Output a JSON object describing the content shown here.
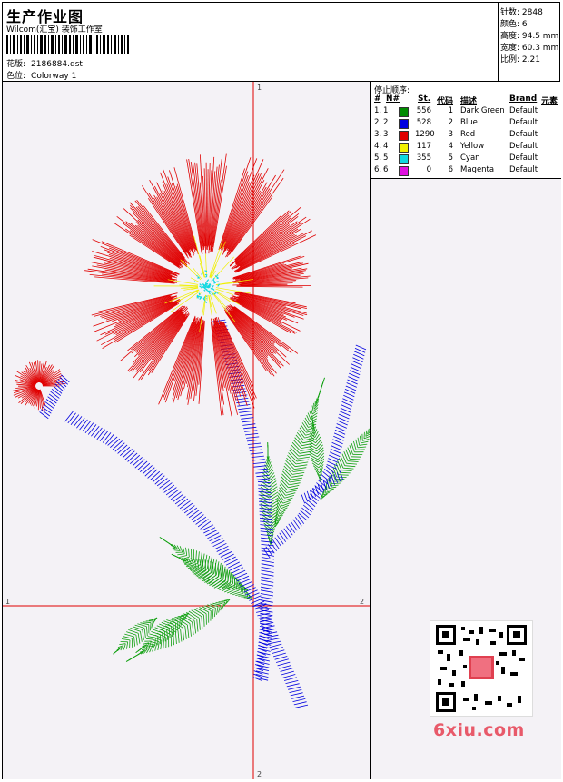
{
  "header": {
    "title": "生产作业图",
    "company": "Wilcom(汇宝) 装饰工作室",
    "design_label": "花版:",
    "design_value": "2186884.dst",
    "colorway_label": "色位:",
    "colorway_value": "Colorway 1"
  },
  "stats": {
    "stitches": "针数: 2848",
    "colors": "颜色: 6",
    "height": "高度: 94.5 mm",
    "width": "宽度: 60.3 mm",
    "ratio": "比例: 2.21"
  },
  "axis_labels": {
    "top": "1",
    "bottom": "2",
    "left": "1",
    "right": "2"
  },
  "panel": {
    "title": "停止顺序:",
    "columns": [
      "#",
      "N#",
      "St.",
      "代码",
      "描述",
      "Brand",
      "元素"
    ],
    "rows": [
      {
        "idx": "1.",
        "n": "1",
        "color": "#008c00",
        "st": "556",
        "code": "1",
        "desc": "Dark Green",
        "brand": "Default"
      },
      {
        "idx": "2.",
        "n": "2",
        "color": "#0000e0",
        "st": "528",
        "code": "2",
        "desc": "Blue",
        "brand": "Default"
      },
      {
        "idx": "3.",
        "n": "3",
        "color": "#e00000",
        "st": "1290",
        "code": "3",
        "desc": "Red",
        "brand": "Default"
      },
      {
        "idx": "4.",
        "n": "4",
        "color": "#f0f000",
        "st": "117",
        "code": "4",
        "desc": "Yellow",
        "brand": "Default"
      },
      {
        "idx": "5.",
        "n": "5",
        "color": "#10d8e0",
        "st": "355",
        "code": "5",
        "desc": "Cyan",
        "brand": "Default"
      },
      {
        "idx": "6.",
        "n": "6",
        "color": "#e010e0",
        "st": "0",
        "code": "6",
        "desc": "Magenta",
        "brand": "Default"
      }
    ]
  },
  "watermark": {
    "site": "6xiu.com"
  },
  "colors": {
    "axis": "#e00000",
    "green": "#10a010",
    "blue": "#0000e0",
    "red": "#e00000",
    "yellow": "#f0f000",
    "cyan": "#10d8e0"
  }
}
